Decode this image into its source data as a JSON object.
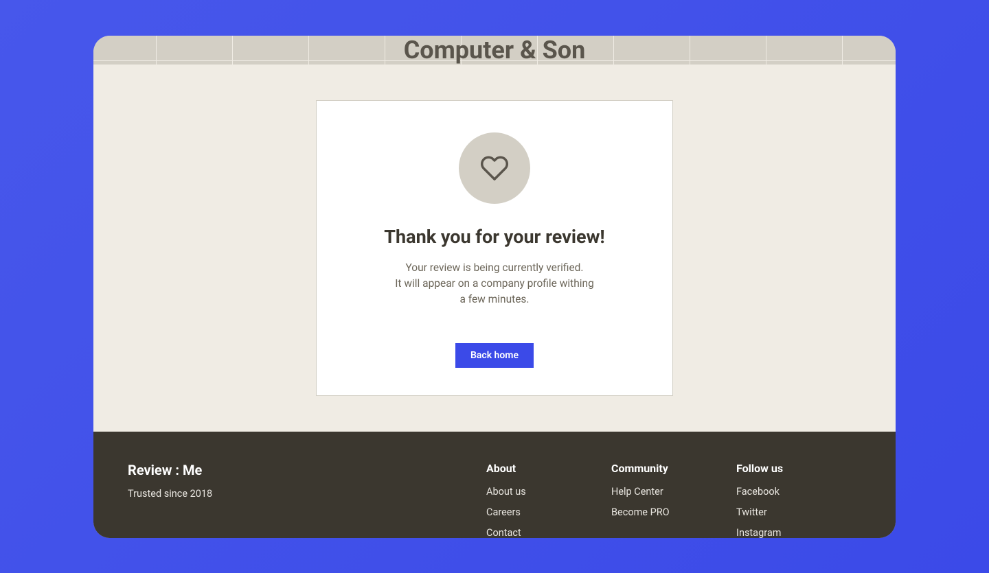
{
  "header": {
    "title": "Computer & Son"
  },
  "card": {
    "title": "Thank you for your review!",
    "text_line1": "Your review is being currently verified.",
    "text_line2": "It will appear on a company profile withing",
    "text_line3": "a few minutes.",
    "button_label": "Back home"
  },
  "footer": {
    "brand": {
      "title": "Review : Me",
      "tagline": "Trusted since 2018"
    },
    "columns": [
      {
        "title": "About",
        "links": [
          "About us",
          "Careers",
          "Contact"
        ]
      },
      {
        "title": "Community",
        "links": [
          "Help Center",
          "Become PRO"
        ]
      },
      {
        "title": "Follow us",
        "links": [
          "Facebook",
          "Twitter",
          "Instagram"
        ]
      }
    ]
  }
}
